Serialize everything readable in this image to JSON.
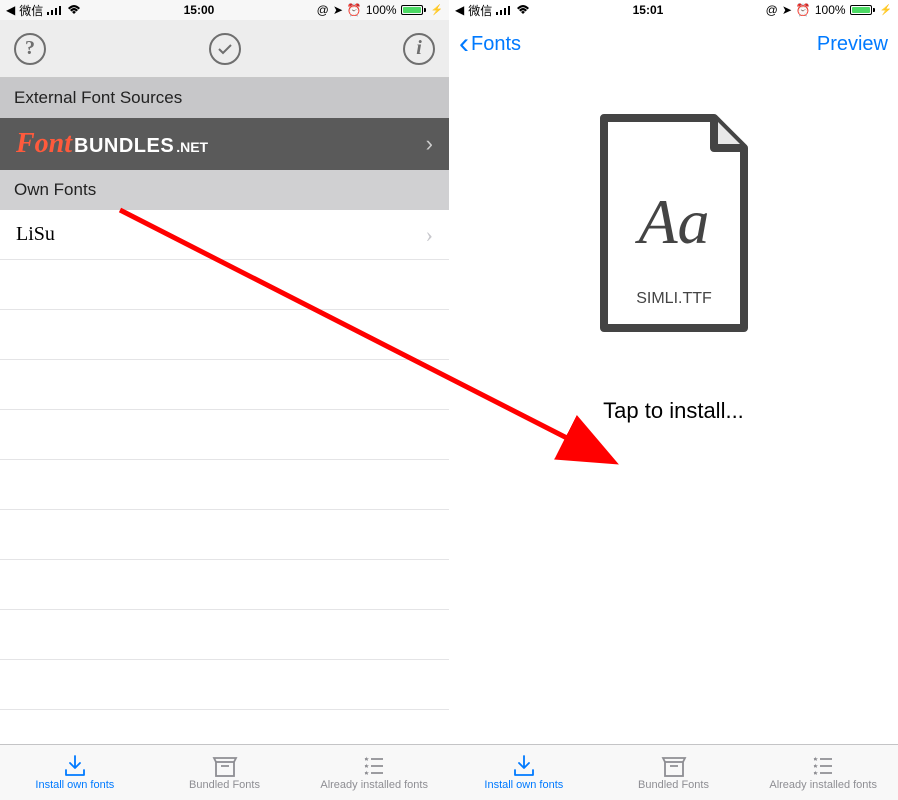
{
  "status": {
    "carrier": "微信",
    "time_left": "15:00",
    "time_right": "15:01",
    "battery": "100%"
  },
  "left": {
    "section_external": "External Font Sources",
    "fontbundles_script": "Font",
    "fontbundles_rest": "BUNDLES",
    "fontbundles_net": ".NET",
    "section_own": "Own Fonts",
    "font_item": "LiSu"
  },
  "right": {
    "back_label": "Fonts",
    "preview_label": "Preview",
    "file_aa": "Aa",
    "file_name": "SIMLI.TTF",
    "tap_install": "Tap to install..."
  },
  "tabs": {
    "install": "Install own fonts",
    "bundled": "Bundled Fonts",
    "installed": "Already installed fonts"
  }
}
